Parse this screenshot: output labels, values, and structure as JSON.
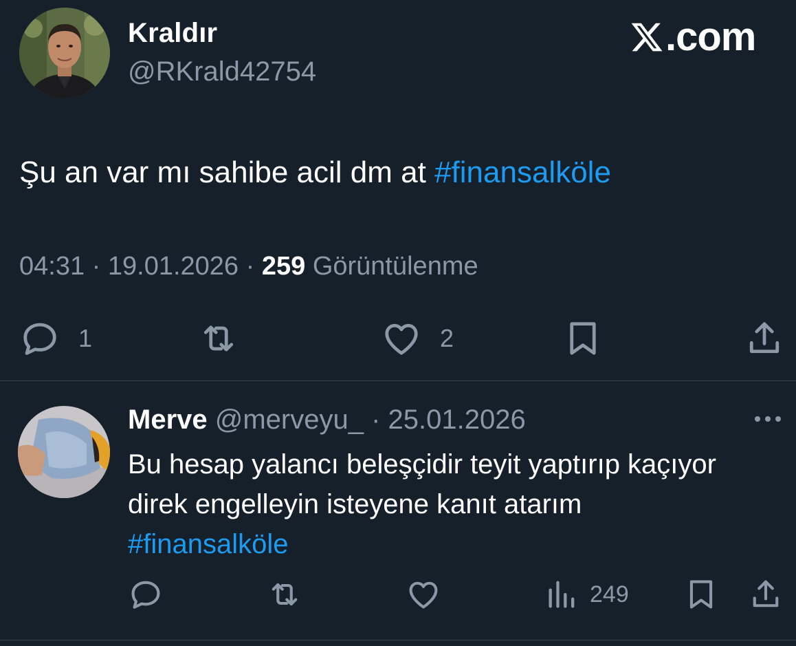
{
  "main_tweet": {
    "author_name": "Kraldır",
    "author_handle": "@RKrald42754",
    "brand": ".com",
    "text": "Şu an var mı sahibe acil dm at ",
    "hashtag": "#finansalköle",
    "time": "04:31",
    "date": "19.01.2026",
    "views_count": "259",
    "views_label": "Görüntülenme",
    "reply_count": "1",
    "like_count": "2",
    "separator": " · "
  },
  "reply": {
    "author_name": "Merve",
    "author_handle": "@merveyu_",
    "date": "25.01.2026",
    "text": "Bu hesap yalancı beleşçidir teyit yaptırıp kaçıyor direk engelleyin isteyene kanıt atarım",
    "hashtag": "#finansalköle",
    "views_count": "249"
  },
  "icons": {
    "reply": "reply-icon",
    "retweet": "retweet-icon",
    "like": "heart-icon",
    "bookmark": "bookmark-icon",
    "share": "share-icon",
    "views": "views-icon",
    "more": "more-icon",
    "brand": "x-logo-icon"
  },
  "colors": {
    "background": "#15202b",
    "hashtag": "#1d9bf0",
    "secondary_text": "#8b98a5",
    "divider": "#38444d"
  }
}
